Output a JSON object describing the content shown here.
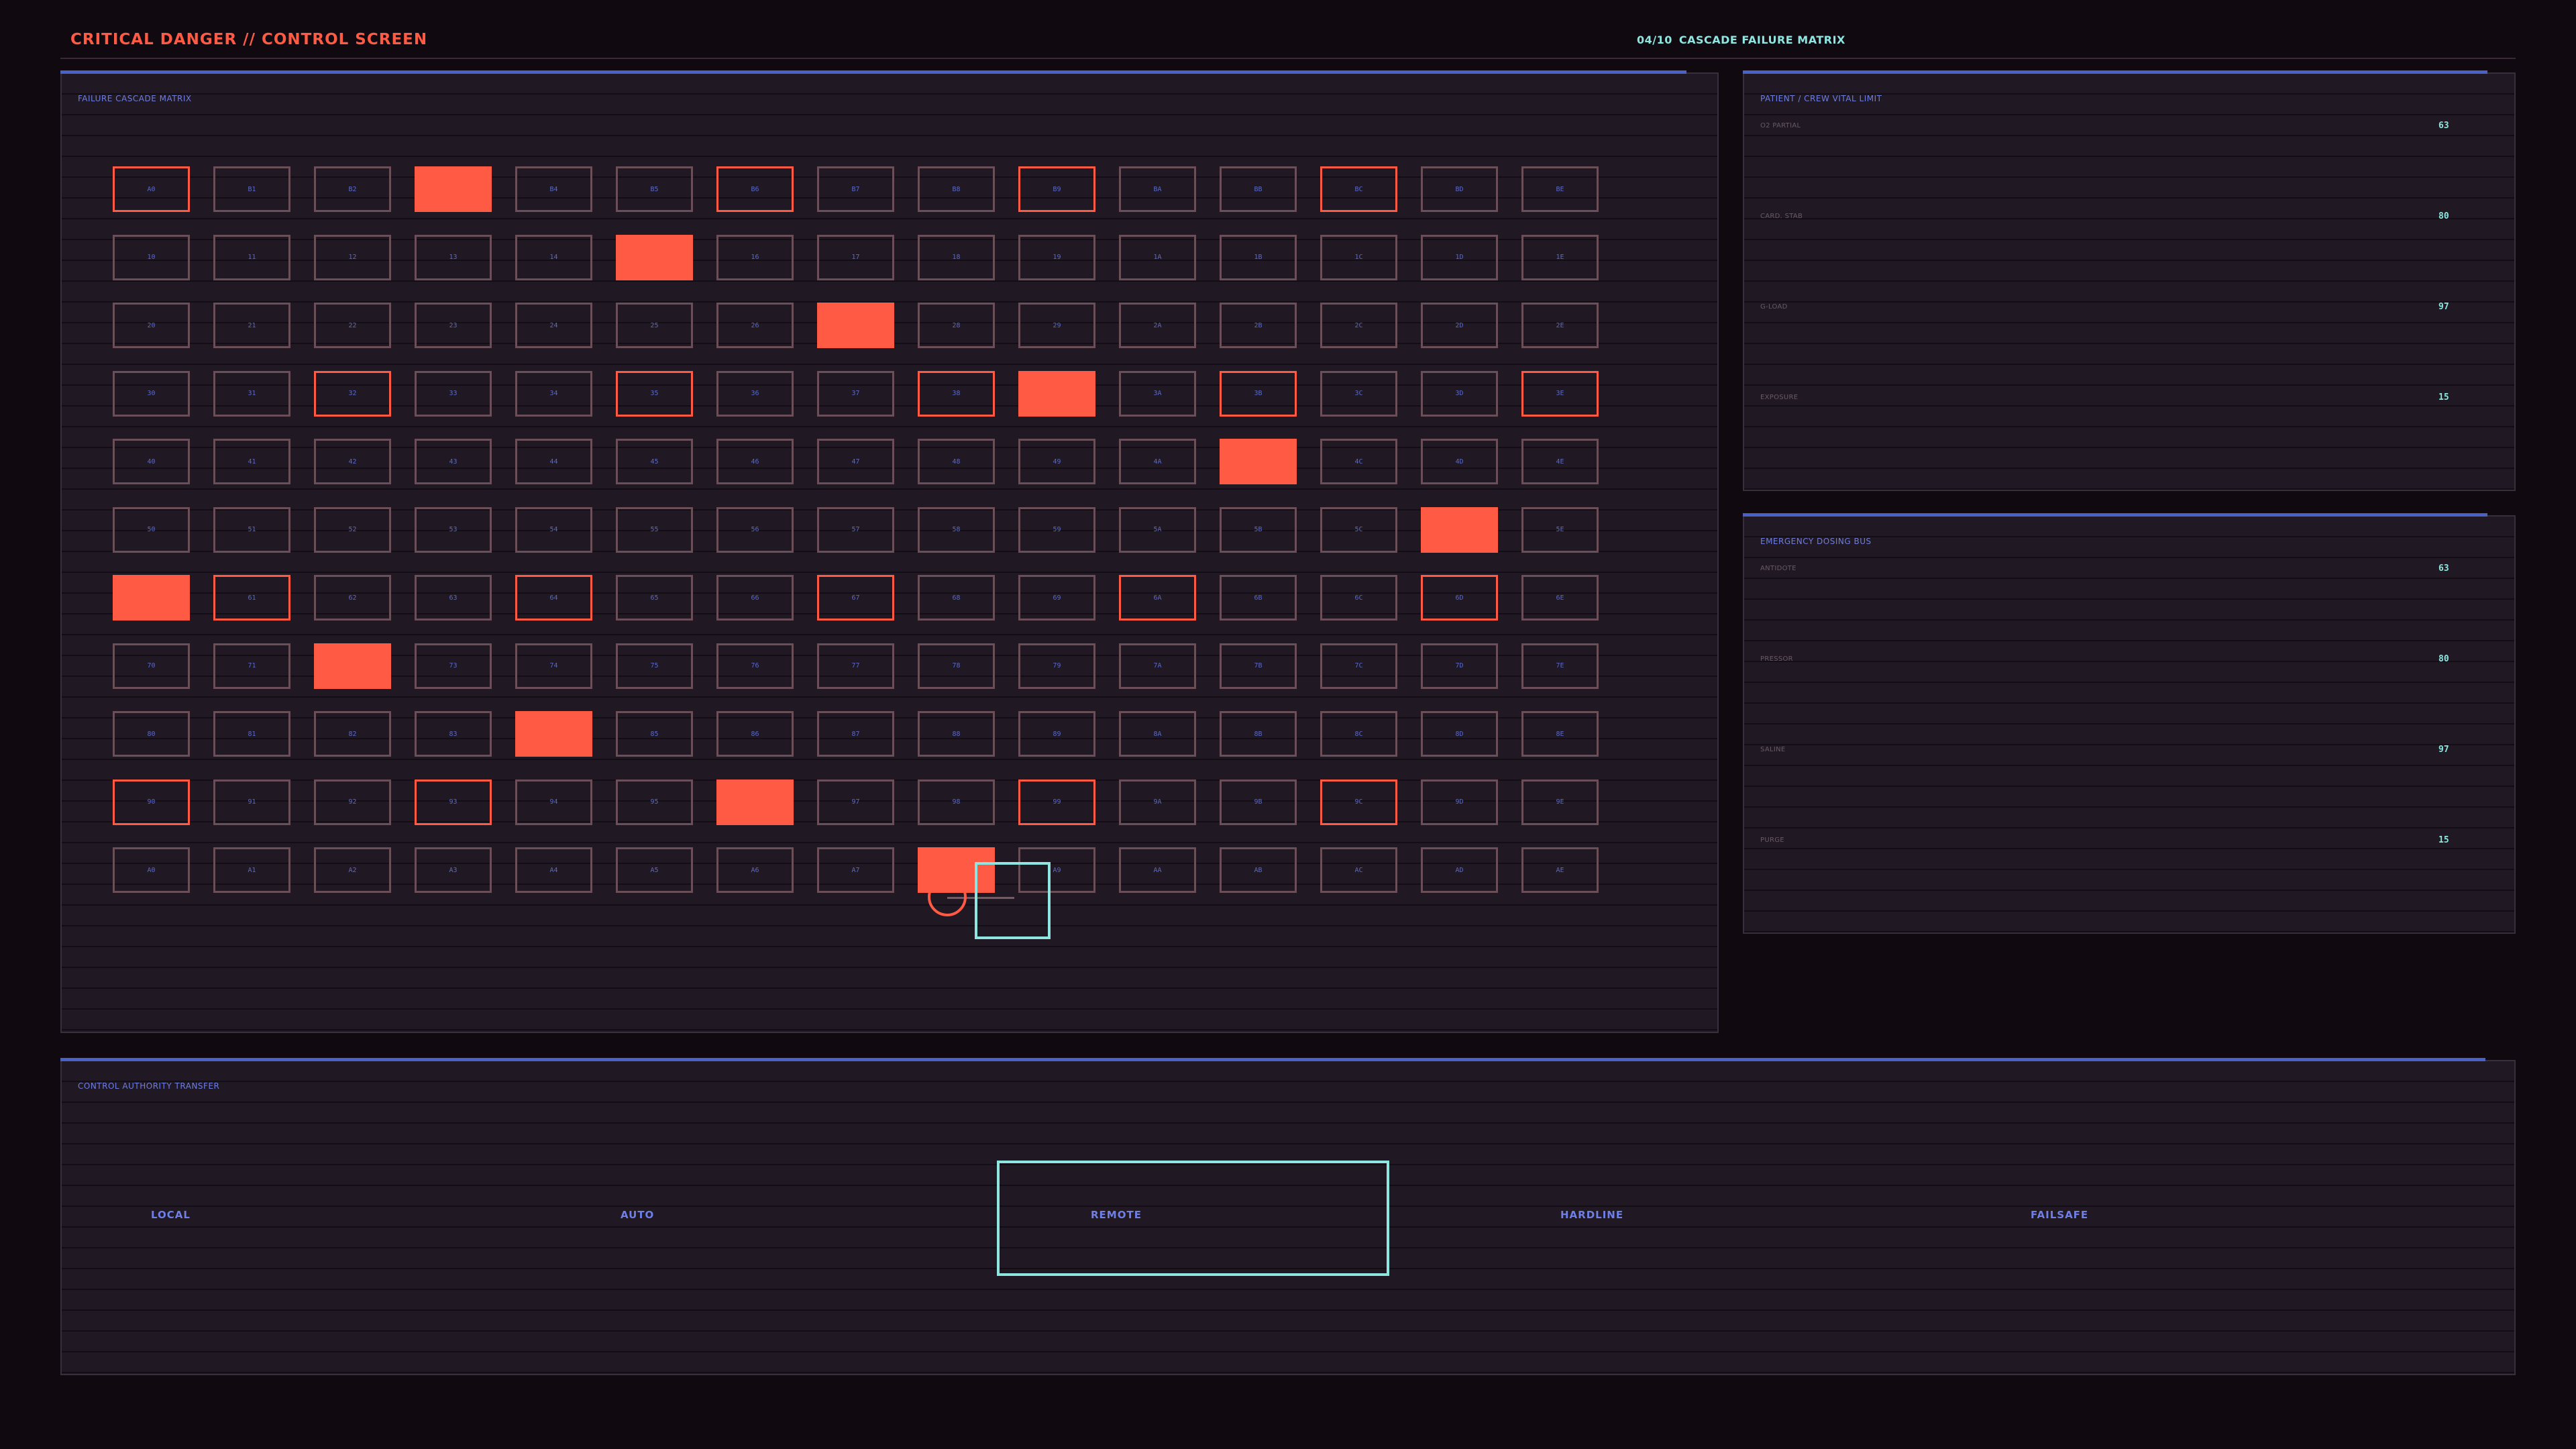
{
  "header": {
    "title": "CRITICAL DANGER // CONTROL SCREEN",
    "step": "04/10",
    "step_label": "CASCADE FAILURE MATRIX"
  },
  "matrix": {
    "label": "FAILURE CASCADE MATRIX",
    "columns": 15,
    "rows": [
      {
        "cells": [
          "A0",
          "B1",
          "B2",
          "",
          "B4",
          "B5",
          "B6",
          "B7",
          "B8",
          "B9",
          "BA",
          "BB",
          "BC",
          "BD",
          "BE"
        ],
        "states": [
          "hot",
          "",
          "",
          "fill",
          "",
          "",
          "hot",
          "",
          "",
          "hot",
          "",
          "",
          "hot",
          "",
          ""
        ]
      },
      {
        "cells": [
          "10",
          "11",
          "12",
          "13",
          "14",
          "",
          "16",
          "17",
          "18",
          "19",
          "1A",
          "1B",
          "1C",
          "1D",
          "1E"
        ],
        "states": [
          "",
          "",
          "",
          "",
          "",
          "fill",
          "",
          "",
          "",
          "",
          "",
          "",
          "",
          "",
          ""
        ]
      },
      {
        "cells": [
          "20",
          "21",
          "22",
          "23",
          "24",
          "25",
          "26",
          "",
          "28",
          "29",
          "2A",
          "2B",
          "2C",
          "2D",
          "2E"
        ],
        "states": [
          "",
          "",
          "",
          "",
          "",
          "",
          "",
          "fill",
          "",
          "",
          "",
          "",
          "",
          "",
          ""
        ]
      },
      {
        "cells": [
          "30",
          "31",
          "32",
          "33",
          "34",
          "35",
          "36",
          "37",
          "38",
          "",
          "3A",
          "3B",
          "3C",
          "3D",
          "3E"
        ],
        "states": [
          "",
          "",
          "hot",
          "",
          "",
          "hot",
          "",
          "",
          "hot",
          "fill",
          "",
          "hot",
          "",
          "",
          "hot"
        ]
      },
      {
        "cells": [
          "40",
          "41",
          "42",
          "43",
          "44",
          "45",
          "46",
          "47",
          "48",
          "49",
          "4A",
          "",
          "4C",
          "4D",
          "4E"
        ],
        "states": [
          "",
          "",
          "",
          "",
          "",
          "",
          "",
          "",
          "",
          "",
          "",
          "fill",
          "",
          "",
          ""
        ]
      },
      {
        "cells": [
          "50",
          "51",
          "52",
          "53",
          "54",
          "55",
          "56",
          "57",
          "58",
          "59",
          "5A",
          "5B",
          "5C",
          "",
          "5E"
        ],
        "states": [
          "",
          "",
          "",
          "",
          "",
          "",
          "",
          "",
          "",
          "",
          "",
          "",
          "",
          "fill",
          ""
        ]
      },
      {
        "cells": [
          "",
          "61",
          "62",
          "63",
          "64",
          "65",
          "66",
          "67",
          "68",
          "69",
          "6A",
          "6B",
          "6C",
          "6D",
          "6E"
        ],
        "states": [
          "fill",
          "hot",
          "",
          "",
          "hot",
          "",
          "",
          "hot",
          "",
          "",
          "hot",
          "",
          "",
          "hot",
          ""
        ]
      },
      {
        "cells": [
          "70",
          "71",
          "",
          "73",
          "74",
          "75",
          "76",
          "77",
          "78",
          "79",
          "7A",
          "7B",
          "7C",
          "7D",
          "7E"
        ],
        "states": [
          "",
          "",
          "fill",
          "",
          "",
          "",
          "",
          "",
          "",
          "",
          "",
          "",
          "",
          "",
          ""
        ]
      },
      {
        "cells": [
          "80",
          "81",
          "82",
          "83",
          "",
          "85",
          "86",
          "87",
          "88",
          "89",
          "8A",
          "8B",
          "8C",
          "8D",
          "8E"
        ],
        "states": [
          "",
          "",
          "",
          "",
          "fill",
          "",
          "",
          "",
          "",
          "",
          "",
          "",
          "",
          "",
          ""
        ]
      },
      {
        "cells": [
          "90",
          "91",
          "92",
          "93",
          "94",
          "95",
          "",
          "97",
          "98",
          "99",
          "9A",
          "9B",
          "9C",
          "9D",
          "9E"
        ],
        "states": [
          "hot",
          "",
          "",
          "hot",
          "",
          "",
          "fill",
          "",
          "",
          "hot",
          "",
          "",
          "hot",
          "",
          ""
        ]
      },
      {
        "cells": [
          "A0",
          "A1",
          "A2",
          "A3",
          "A4",
          "A5",
          "A6",
          "A7",
          "",
          "A9",
          "AA",
          "AB",
          "AC",
          "AD",
          "AE"
        ],
        "states": [
          "",
          "",
          "",
          "",
          "",
          "",
          "",
          "",
          "fill",
          "",
          "",
          "",
          "",
          "",
          ""
        ]
      }
    ]
  },
  "vitals": {
    "label": "PATIENT / CREW VITAL LIMIT",
    "rows": [
      {
        "label": "O2 PARTIAL",
        "value": "63"
      },
      {
        "label": "CARD. STAB",
        "value": "80"
      },
      {
        "label": "G-LOAD",
        "value": "97"
      },
      {
        "label": "EXPOSURE",
        "value": "15"
      }
    ]
  },
  "dosing": {
    "label": "EMERGENCY DOSING BUS",
    "rows": [
      {
        "label": "ANTIDOTE",
        "value": "63"
      },
      {
        "label": "PRESSOR",
        "value": "80"
      },
      {
        "label": "SALINE",
        "value": "97"
      },
      {
        "label": "PURGE",
        "value": "15"
      }
    ]
  },
  "control": {
    "label": "CONTROL AUTHORITY TRANSFER",
    "modes": [
      "LOCAL",
      "AUTO",
      "REMOTE",
      "HARDLINE",
      "FAILSAFE"
    ],
    "selected": "REMOTE"
  },
  "colors": {
    "danger": "#ff5a44",
    "accent": "#4a62c8",
    "highlight": "#8fe6e0",
    "background": "#100a10",
    "panel": "#201822"
  }
}
